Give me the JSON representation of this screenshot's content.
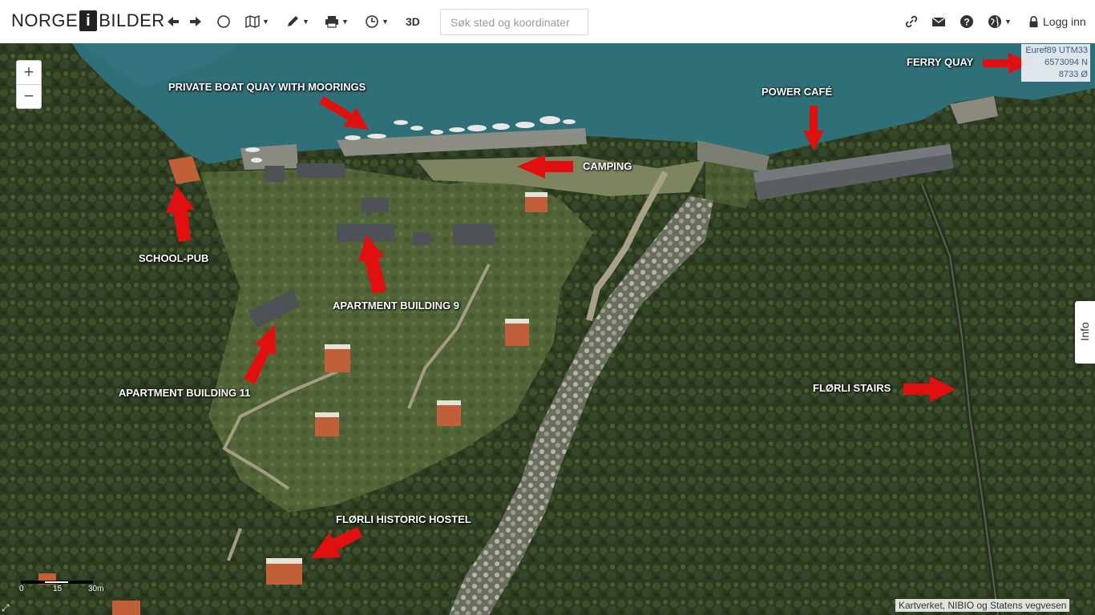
{
  "header": {
    "logo_left": "NORGE",
    "logo_box": "i",
    "logo_right": "BILDER",
    "button_3d": "3D",
    "login_label": "Logg inn"
  },
  "search": {
    "placeholder": "Søk sted og koordinater"
  },
  "map": {
    "zoom_in": "+",
    "zoom_out": "−",
    "coordinates": {
      "system": "Euref89 UTM33",
      "north": "6573094 N",
      "east": "8733 Ø"
    },
    "info_tab": "Info",
    "attribution": "Kartverket, NIBIO og Statens vegvesen",
    "scale": {
      "label_0": "0",
      "label_mid": "15",
      "label_end": "30m"
    },
    "annotations": [
      {
        "id": "ferry-quay",
        "text": "FERRY QUAY"
      },
      {
        "id": "private-boat-quay",
        "text": "PRIVATE BOAT QUAY WITH MOORINGS"
      },
      {
        "id": "power-cafe",
        "text": "POWER CAFÉ"
      },
      {
        "id": "camping",
        "text": "CAMPING"
      },
      {
        "id": "school-pub",
        "text": "SCHOOL-PUB"
      },
      {
        "id": "apartment-9",
        "text": "APARTMENT BUILDING 9"
      },
      {
        "id": "apartment-11",
        "text": "APARTMENT BUILDING 11"
      },
      {
        "id": "florli-stairs",
        "text": "FLØRLI STAIRS"
      },
      {
        "id": "historic-hostel",
        "text": "FLØRLI HISTORIC HOSTEL"
      }
    ],
    "colors": {
      "water": "#2f6f78",
      "forest": "#2f3d22",
      "arrow": "#e01010",
      "roof_red": "#c0603a",
      "roof_gray": "#55585c"
    }
  },
  "icons": [
    "back-arrow-icon",
    "forward-arrow-icon",
    "circle-icon",
    "map-icon",
    "pencil-icon",
    "print-icon",
    "clock-icon",
    "link-icon",
    "mail-icon",
    "help-icon",
    "globe-icon",
    "lock-icon"
  ]
}
